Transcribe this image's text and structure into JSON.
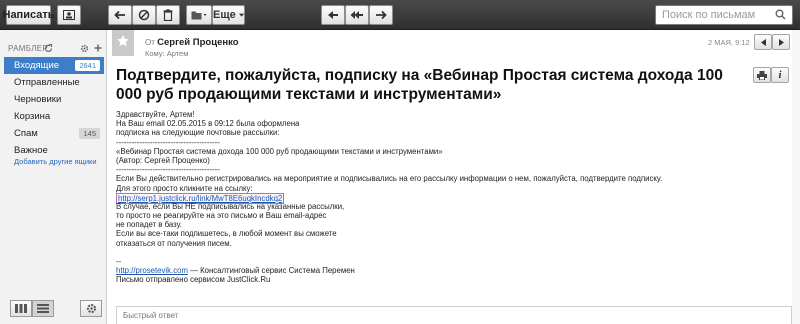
{
  "toolbar": {
    "compose_label": "Написать",
    "more_label": "Еще",
    "search_placeholder": "Поиск по письмам"
  },
  "sidebar": {
    "account": "РАМБЛЕР",
    "folders": [
      {
        "label": "Входящие",
        "count": "2641"
      },
      {
        "label": "Отправленные",
        "count": ""
      },
      {
        "label": "Черновики",
        "count": ""
      },
      {
        "label": "Корзина",
        "count": ""
      },
      {
        "label": "Спам",
        "count": "145"
      },
      {
        "label": "Важное",
        "count": ""
      }
    ],
    "add_boxes": "Добавить другие ящики"
  },
  "message": {
    "from_prefix": "От",
    "from_name": "Сергей Проценко",
    "to_line": "Кому: Артем",
    "date": "2 МАЯ, 9:12",
    "subject": "Подтвердите, пожалуйста, подписку на «Вебинар Простая система дохода 100 000 руб продающими текстами и инструментами»",
    "body": {
      "l1": "Здравствуйте, Артем!",
      "l2": "На Ваш email 02.05.2015 в 09:12 была оформлена",
      "l3": "подписка на следующие почтовые рассылки:",
      "l4": "----------------------------------------",
      "l5": "«Вебинар Простая система дохода 100 000 руб продающими текстами и инструментами»",
      "l6": "(Автор: Сергей Проценко)",
      "l7": "----------------------------------------",
      "l8": "Если Вы действительно регистрировались на мероприятие и подписывались на его рассылку информации о нем, пожалуйста, подтвердите подписку.",
      "l9": "Для этого просто кликните на ссылку:",
      "link": "http://serp1.justclick.ru/link/MwT8E6uqkIncdkq2",
      "l10": "В случае, если Вы НЕ подписывались на указанные рассылки,",
      "l11": "то просто не реагируйте на это письмо и Ваш email-адрес",
      "l12": "не попадет в базу.",
      "l13": "Если вы все-таки подпишетесь, в любой момент вы сможете",
      "l14": "отказаться от получения писем.",
      "l15": "--",
      "footer_link": "http://prosetevik.com",
      "footer_text": " — Консалтинговый сервис Система Перемен",
      "footer_2": "Письмо отправлено сервисом JustClick.Ru"
    },
    "reply_placeholder": "Быстрый ответ"
  },
  "icons": {
    "compose": "compose-icon",
    "back": "arrow-left-icon",
    "block": "block-icon",
    "delete": "trash-icon",
    "folder": "folder-icon",
    "reply": "reply-icon",
    "reply_all": "reply-all-icon",
    "forward": "forward-icon",
    "search": "search-icon",
    "refresh": "refresh-icon",
    "settings": "gear-icon",
    "add": "plus-icon",
    "star": "star-icon",
    "print": "print-icon",
    "info": "info-icon"
  },
  "colors": {
    "accent": "#3e7ec9",
    "toolbar": "#3a3a3a"
  }
}
